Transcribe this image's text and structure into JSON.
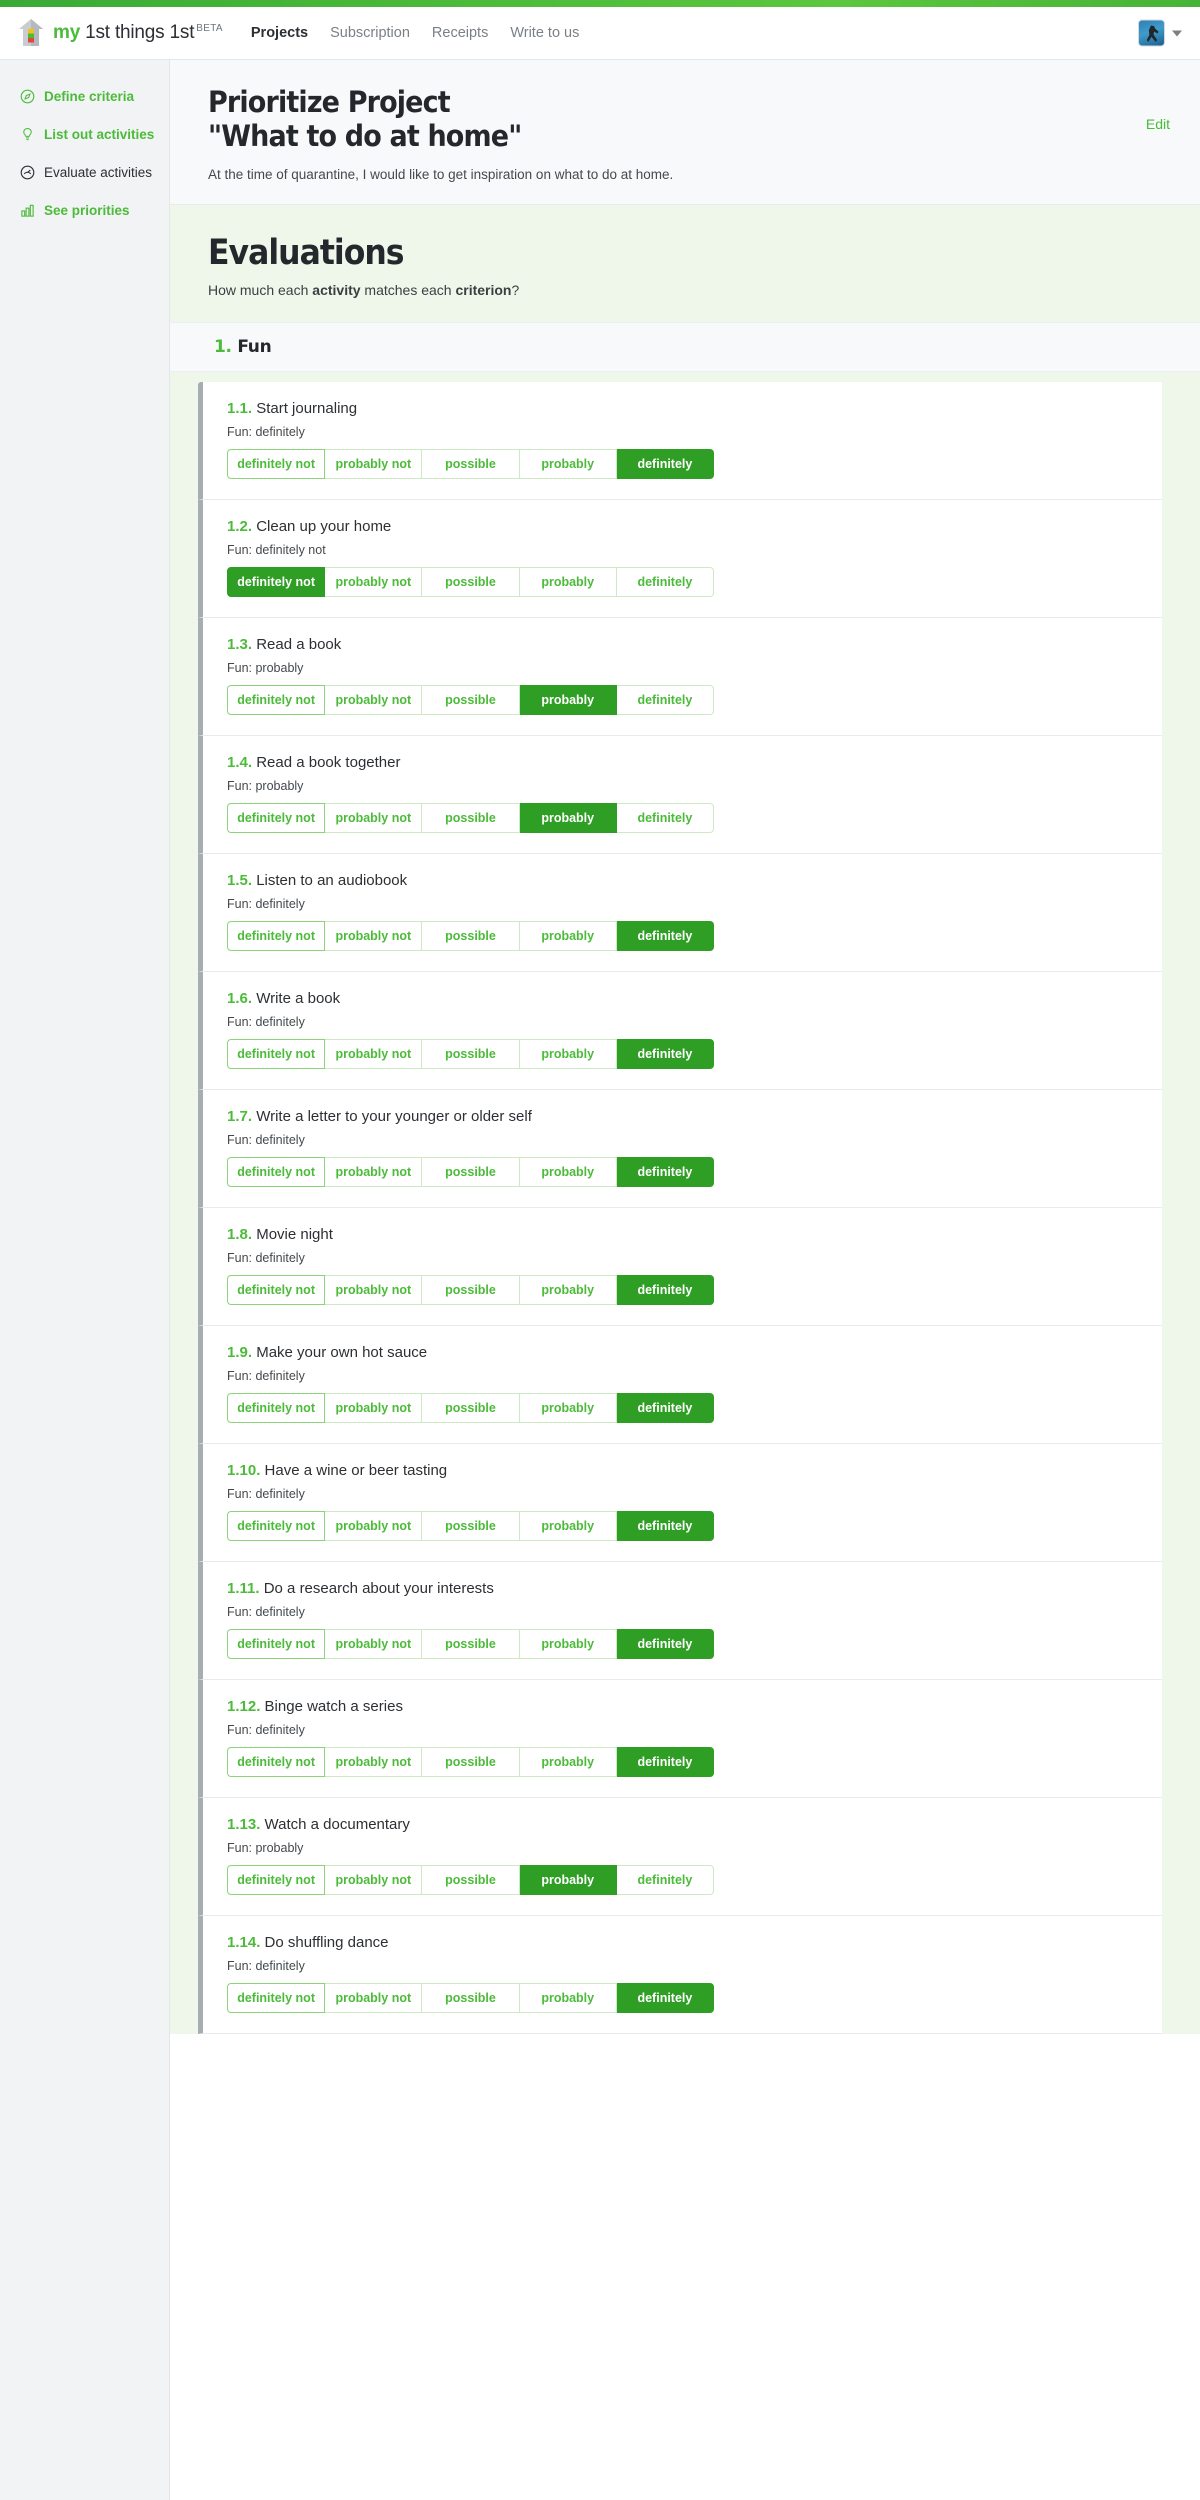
{
  "brand": {
    "my": "my",
    "rest": " 1st things 1st",
    "beta": "BETA",
    "logo_icon": "house-logo-icon"
  },
  "nav": {
    "links": [
      {
        "label": "Projects",
        "active": true
      },
      {
        "label": "Subscription",
        "active": false
      },
      {
        "label": "Receipts",
        "active": false
      },
      {
        "label": "Write to us",
        "active": false
      }
    ],
    "avatar_icon": "user-avatar",
    "caret_icon": "chevron-down-icon"
  },
  "sidebar": {
    "items": [
      {
        "label": "Define criteria",
        "icon": "compass-icon",
        "active": true
      },
      {
        "label": "List out activities",
        "icon": "lightbulb-icon",
        "active": true
      },
      {
        "label": "Evaluate activities",
        "icon": "gauge-icon",
        "active": false
      },
      {
        "label": "See priorities",
        "icon": "bar-chart-icon",
        "active": true
      }
    ]
  },
  "project": {
    "title_line1": "Prioritize Project",
    "title_line2": "\"What to do at home\"",
    "description": "At the time of quarantine, I would like to get inspiration on what to do at home.",
    "edit_label": "Edit"
  },
  "evaluations": {
    "heading": "Evaluations",
    "sub_prefix": "How much each ",
    "sub_bold1": "activity",
    "sub_middle": " matches each ",
    "sub_bold2": "criterion",
    "sub_suffix": "?"
  },
  "criterion": {
    "number": "1.",
    "name": "Fun"
  },
  "scale": {
    "options": [
      "definitely not",
      "probably not",
      "possible",
      "probably",
      "definitely"
    ],
    "selected_color": "#2f9e25",
    "accent_color": "#4cbb3a"
  },
  "activities": [
    {
      "num": "1.1.",
      "name": "Start journaling",
      "meta": "Fun: definitely",
      "selected": 4
    },
    {
      "num": "1.2.",
      "name": "Clean up your home",
      "meta": "Fun: definitely not",
      "selected": 0
    },
    {
      "num": "1.3.",
      "name": "Read a book",
      "meta": "Fun: probably",
      "selected": 3
    },
    {
      "num": "1.4.",
      "name": "Read a book together",
      "meta": "Fun: probably",
      "selected": 3
    },
    {
      "num": "1.5.",
      "name": "Listen to an audiobook",
      "meta": "Fun: definitely",
      "selected": 4
    },
    {
      "num": "1.6.",
      "name": "Write a book",
      "meta": "Fun: definitely",
      "selected": 4
    },
    {
      "num": "1.7.",
      "name": "Write a letter to your younger or older self",
      "meta": "Fun: definitely",
      "selected": 4
    },
    {
      "num": "1.8.",
      "name": "Movie night",
      "meta": "Fun: definitely",
      "selected": 4
    },
    {
      "num": "1.9.",
      "name": "Make your own hot sauce",
      "meta": "Fun: definitely",
      "selected": 4
    },
    {
      "num": "1.10.",
      "name": "Have a wine or beer tasting",
      "meta": "Fun: definitely",
      "selected": 4
    },
    {
      "num": "1.11.",
      "name": "Do a research about your interests",
      "meta": "Fun: definitely",
      "selected": 4
    },
    {
      "num": "1.12.",
      "name": "Binge watch a series",
      "meta": "Fun: definitely",
      "selected": 4
    },
    {
      "num": "1.13.",
      "name": "Watch a documentary",
      "meta": "Fun: probably",
      "selected": 3
    },
    {
      "num": "1.14.",
      "name": "Do shuffling dance",
      "meta": "Fun: definitely",
      "selected": 4
    }
  ]
}
